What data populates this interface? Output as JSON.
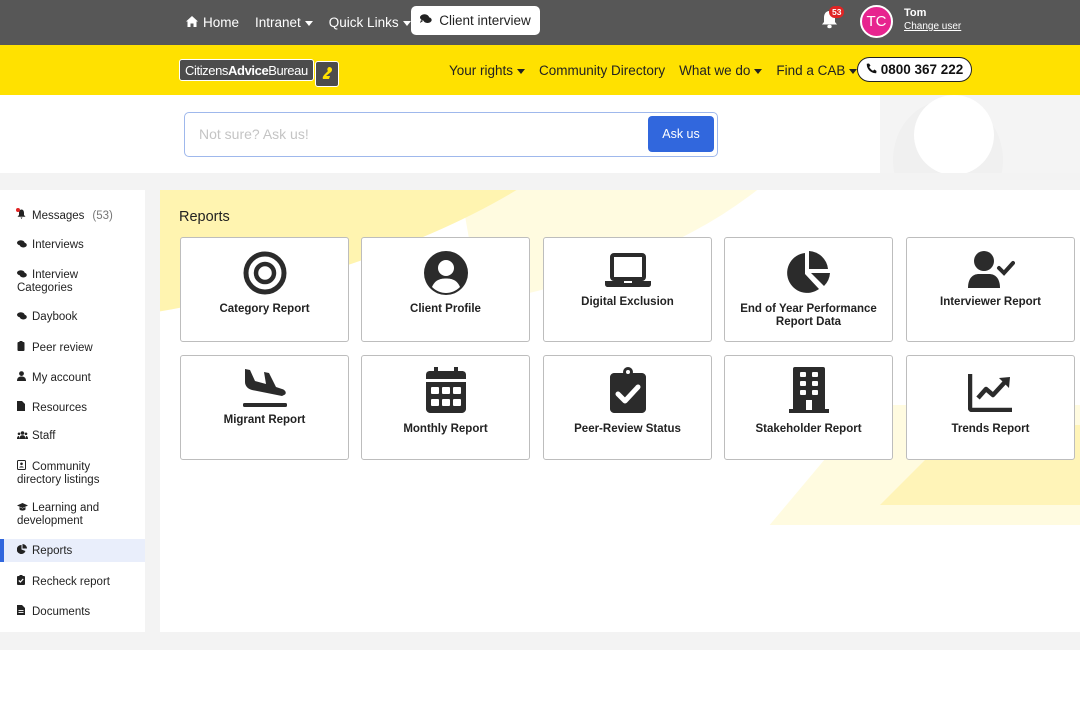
{
  "topbar": {
    "nav": [
      {
        "label": "Home",
        "icon": "home-icon",
        "has_dropdown": false
      },
      {
        "label": "Intranet",
        "has_dropdown": true
      },
      {
        "label": "Quick Links",
        "has_dropdown": true
      }
    ],
    "client_interview_label": "Client interview",
    "notifications_count": "53",
    "user": {
      "initials": "TC",
      "name": "Tom",
      "change_user_label": "Change user",
      "avatar_color": "#e7248f"
    }
  },
  "header": {
    "logo": {
      "part1": "Citizens",
      "part2": "Advice",
      "part3": "Bureau"
    },
    "nav": [
      {
        "label": "Your rights",
        "has_dropdown": true
      },
      {
        "label": "Community Directory",
        "has_dropdown": false
      },
      {
        "label": "What we do",
        "has_dropdown": true
      },
      {
        "label": "Find a CAB",
        "has_dropdown": true
      }
    ],
    "phone": "0800 367 222",
    "brand_color": "#ffe100"
  },
  "search": {
    "placeholder": "Not sure? Ask us!",
    "value": "",
    "button_label": "Ask us",
    "button_color": "#3167dd"
  },
  "sidebar": {
    "items": [
      {
        "label": "Messages",
        "count": "(53)",
        "icon": "bell-icon"
      },
      {
        "label": "Interviews",
        "icon": "comments-icon"
      },
      {
        "label": "Interview Categories",
        "icon": "comments-icon"
      },
      {
        "label": "Daybook",
        "icon": "comments-icon"
      },
      {
        "label": "Peer review",
        "icon": "clipboard-icon"
      },
      {
        "label": "My account",
        "icon": "user-icon"
      },
      {
        "label": "Resources",
        "icon": "file-icon"
      },
      {
        "label": "Staff",
        "icon": "users-icon"
      },
      {
        "label": "Community directory listings",
        "icon": "address-book-icon"
      },
      {
        "label": "Learning and development",
        "icon": "graduation-cap-icon"
      },
      {
        "label": "Reports",
        "icon": "pie-chart-icon",
        "active": true
      },
      {
        "label": "Recheck report",
        "icon": "clipboard-check-icon"
      },
      {
        "label": "Documents",
        "icon": "file-text-icon"
      }
    ]
  },
  "content": {
    "title": "Reports",
    "cards": [
      {
        "label": "Category Report",
        "icon": "bullseye-icon"
      },
      {
        "label": "Client Profile",
        "icon": "user-circle-icon"
      },
      {
        "label": "Digital Exclusion",
        "icon": "laptop-icon"
      },
      {
        "label": "End of Year Performance Report Data",
        "icon": "pie-chart-icon"
      },
      {
        "label": "Interviewer Report",
        "icon": "user-check-icon"
      },
      {
        "label": "Migrant Report",
        "icon": "plane-arrival-icon"
      },
      {
        "label": "Monthly Report",
        "icon": "calendar-icon"
      },
      {
        "label": "Peer-Review Status",
        "icon": "clipboard-check-icon"
      },
      {
        "label": "Stakeholder Report",
        "icon": "building-icon"
      },
      {
        "label": "Trends Report",
        "icon": "chart-line-icon"
      }
    ]
  }
}
